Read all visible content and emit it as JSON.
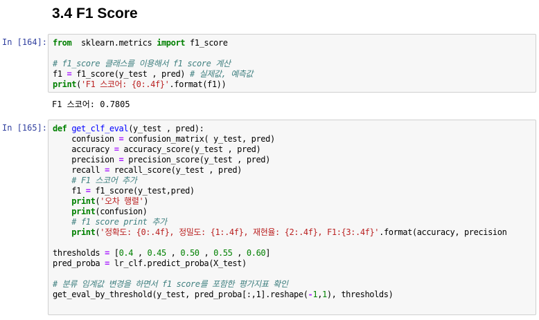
{
  "heading": "3.4 F1 Score",
  "cells": [
    {
      "prompt": "In [164]:",
      "lines": [
        [
          [
            "kw",
            "from"
          ],
          [
            "",
            "  sklearn.metrics "
          ],
          [
            "kw",
            "import"
          ],
          [
            "",
            " f1_score"
          ]
        ],
        [],
        [
          [
            "cm",
            "# f1_score 클래스를 이용해서 f1 score 계산"
          ]
        ],
        [
          [
            "",
            "f1 "
          ],
          [
            "op",
            "="
          ],
          [
            "",
            " f1_score(y_test , pred) "
          ],
          [
            "cm",
            "# 실제값, 예측값"
          ]
        ],
        [
          [
            "kw",
            "print"
          ],
          [
            "",
            "("
          ],
          [
            "st",
            "'F1 스코어: {0:.4f}'"
          ],
          [
            "",
            ".format(f1))"
          ]
        ]
      ],
      "output": "F1 스코어: 0.7805"
    },
    {
      "prompt": "In [165]:",
      "lines": [
        [
          [
            "kw",
            "def"
          ],
          [
            "",
            " "
          ],
          [
            "fn",
            "get_clf_eval"
          ],
          [
            "",
            "(y_test , pred):"
          ]
        ],
        [
          [
            "",
            "    confusion "
          ],
          [
            "op",
            "="
          ],
          [
            "",
            " confusion_matrix( y_test, pred)"
          ]
        ],
        [
          [
            "",
            "    accuracy "
          ],
          [
            "op",
            "="
          ],
          [
            "",
            " accuracy_score(y_test , pred)"
          ]
        ],
        [
          [
            "",
            "    precision "
          ],
          [
            "op",
            "="
          ],
          [
            "",
            " precision_score(y_test , pred)"
          ]
        ],
        [
          [
            "",
            "    recall "
          ],
          [
            "op",
            "="
          ],
          [
            "",
            " recall_score(y_test , pred)"
          ]
        ],
        [
          [
            "cm",
            "    # F1 스코어 추가"
          ]
        ],
        [
          [
            "",
            "    f1 "
          ],
          [
            "op",
            "="
          ],
          [
            "",
            " f1_score(y_test,pred)"
          ]
        ],
        [
          [
            "kw",
            "    print"
          ],
          [
            "",
            "("
          ],
          [
            "st",
            "'오차 행렬'"
          ],
          [
            "",
            ")"
          ]
        ],
        [
          [
            "kw",
            "    print"
          ],
          [
            "",
            "(confusion)"
          ]
        ],
        [
          [
            "cm",
            "    # f1 score print 추가"
          ]
        ],
        [
          [
            "kw",
            "    print"
          ],
          [
            "",
            "("
          ],
          [
            "st",
            "'정확도: {0:.4f}, 정밀도: {1:.4f}, 재현율: {2:.4f}, F1:{3:.4f}'"
          ],
          [
            "",
            ".format(accuracy, precision"
          ]
        ],
        [],
        [
          [
            "",
            "thresholds "
          ],
          [
            "op",
            "="
          ],
          [
            "",
            " ["
          ],
          [
            "nu",
            "0.4"
          ],
          [
            "",
            " , "
          ],
          [
            "nu",
            "0.45"
          ],
          [
            "",
            " , "
          ],
          [
            "nu",
            "0.50"
          ],
          [
            "",
            " , "
          ],
          [
            "nu",
            "0.55"
          ],
          [
            "",
            " , "
          ],
          [
            "nu",
            "0.60"
          ],
          [
            "",
            "]"
          ]
        ],
        [
          [
            "",
            "pred_proba "
          ],
          [
            "op",
            "="
          ],
          [
            "",
            " lr_clf.predict_proba(X_test)"
          ]
        ],
        [],
        [
          [
            "cm",
            "# 분류 임계값 변경을 하면서 f1 score를 포함한 평가지표 확인"
          ]
        ],
        [
          [
            "",
            "get_eval_by_threshold(y_test, pred_proba[:,1].reshape("
          ],
          [
            "op",
            "-"
          ],
          [
            "nu",
            "1"
          ],
          [
            "",
            ","
          ],
          [
            "nu",
            "1"
          ],
          [
            "",
            "), thresholds)"
          ]
        ]
      ]
    }
  ]
}
